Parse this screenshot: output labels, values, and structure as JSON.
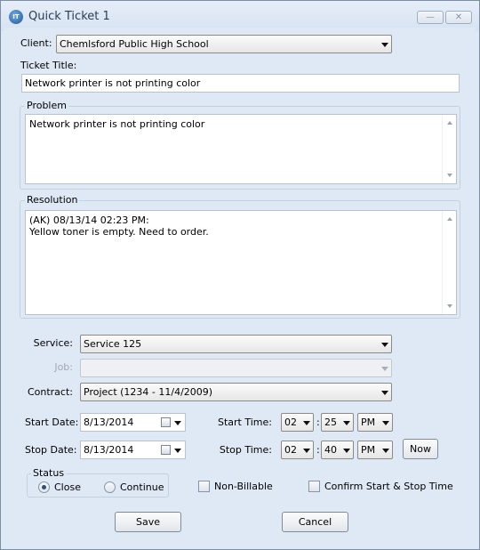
{
  "window": {
    "title": "Quick Ticket 1",
    "minimize_glyph": "—",
    "close_glyph": "✕"
  },
  "client": {
    "label": "Client:",
    "value": "Chemlsford Public High School"
  },
  "ticket_title": {
    "label": "Ticket Title:",
    "value": "Network printer is not printing color"
  },
  "problem": {
    "label": "Problem",
    "value": "Network printer is not printing color"
  },
  "resolution": {
    "label": "Resolution",
    "value": "(AK) 08/13/14 02:23 PM:\nYellow toner is empty. Need to order."
  },
  "service": {
    "label": "Service:",
    "value": "Service 125"
  },
  "job": {
    "label": "Job:",
    "value": ""
  },
  "contract": {
    "label": "Contract:",
    "value": "Project (1234 - 11/4/2009)"
  },
  "start_date": {
    "label": "Start Date:",
    "value": "8/13/2014"
  },
  "stop_date": {
    "label": "Stop Date:",
    "value": "8/13/2014"
  },
  "start_time": {
    "label": "Start Time:",
    "hour": "02",
    "minute": "25",
    "ampm": "PM"
  },
  "stop_time": {
    "label": "Stop Time:",
    "hour": "02",
    "minute": "40",
    "ampm": "PM"
  },
  "separator": ":",
  "now_button": "Now",
  "status": {
    "label": "Status",
    "options": [
      "Close",
      "Continue"
    ],
    "selected": "Close"
  },
  "non_billable": {
    "label": "Non-Billable",
    "checked": false
  },
  "confirm_times": {
    "label": "Confirm Start & Stop Time",
    "checked": false
  },
  "buttons": {
    "save": "Save",
    "cancel": "Cancel"
  },
  "colors": {
    "window_bg": "#dfe9f5",
    "border": "#7b8ea6",
    "title_text": "#2b3d55"
  }
}
